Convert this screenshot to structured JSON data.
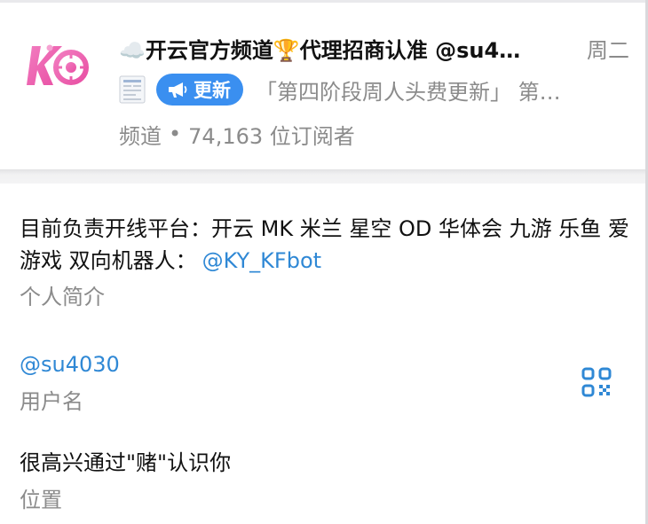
{
  "header": {
    "title": "☁️开云官方频道🏆代理招商认准 @su4…",
    "date": "周二",
    "update_badge": "更新",
    "message_snippet": "「第四阶段周人头费更新」 第…",
    "type_label": "频道",
    "subscribers": "74,163 位订阅者"
  },
  "bio": {
    "text": "目前负责开线平台：开云 MK 米兰 星空 OD 华体会 九游 乐鱼 爱游戏 双向机器人：",
    "mention": "@KY_KFbot",
    "label": "个人简介"
  },
  "username": {
    "value": "@su4030",
    "label": "用户名"
  },
  "location": {
    "value": "很高兴通过\"赌\"认识你",
    "label": "位置"
  },
  "icons": {
    "avatar": "kaiyun-logo",
    "doc": "document-thumbnail-icon",
    "megaphone": "megaphone-icon",
    "qr": "qr-code-icon"
  },
  "colors": {
    "accent": "#3a8ff0",
    "link": "#2f88d5",
    "muted": "#8b8b8b",
    "logo_pink": "#ef5fae"
  }
}
